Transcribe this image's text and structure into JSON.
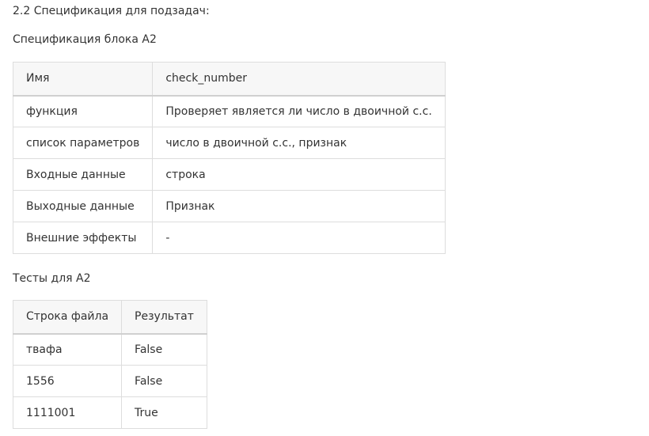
{
  "section_title": "2.2 Спецификация для подзадач:",
  "spec": {
    "title": "Спецификация блока А2",
    "rows": [
      {
        "key": "Имя",
        "value": "check_number"
      },
      {
        "key": "функция",
        "value": "Проверяет является ли число в двоичной с.с."
      },
      {
        "key": "список параметров",
        "value": "число в двоичной с.с., признак"
      },
      {
        "key": "Входные данные",
        "value": "строка"
      },
      {
        "key": "Выходные данные",
        "value": "Признак"
      },
      {
        "key": "Внешние эффекты",
        "value": "-"
      }
    ]
  },
  "tests": {
    "title": "Тесты для А2",
    "headers": [
      "Строка файла",
      "Результат"
    ],
    "rows": [
      [
        "твафа",
        "False"
      ],
      [
        "1556",
        "False"
      ],
      [
        "1111001",
        "True"
      ]
    ]
  }
}
